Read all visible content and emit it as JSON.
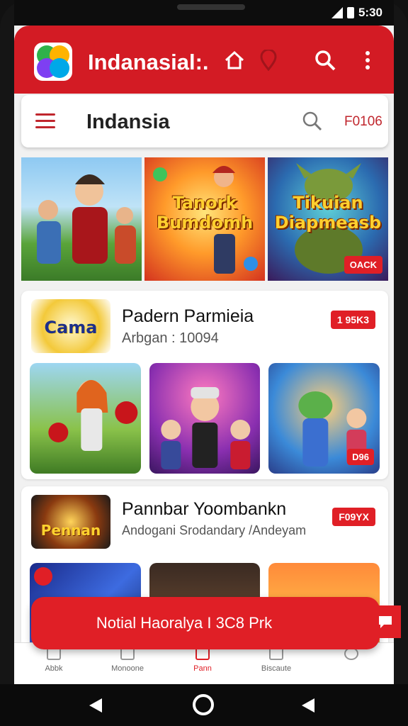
{
  "status": {
    "time": "5:30"
  },
  "app": {
    "title": "Indanasial:."
  },
  "subheader": {
    "title": "Indansia",
    "code": "F0106"
  },
  "banners": [
    {
      "title": "",
      "badge": ""
    },
    {
      "title": "Tanork Bumdomh",
      "badge": ""
    },
    {
      "title": "Tikuian Diapmeasb",
      "badge": "OACK"
    }
  ],
  "sections": [
    {
      "logo_text": "Cama",
      "title": "Padern Parmieia",
      "subtitle": "Arbgan : 10094",
      "badge": "1 95K3",
      "thumb_badges": [
        "",
        "",
        "D96"
      ]
    },
    {
      "logo_text": "Pennan",
      "title": "Pannbar Yoombankn",
      "subtitle": "Andogani Srodandary /Andeyam",
      "badge": "F09YX",
      "thumb_badges": [
        "",
        "",
        ""
      ]
    }
  ],
  "toast": {
    "text": "Notial Haoralya I 3C8 Prk"
  },
  "nav": {
    "items": [
      "Abbk",
      "Monoone",
      "Pann",
      "Biscaute",
      ""
    ]
  },
  "colors": {
    "brand_red": "#d31b24",
    "badge_red": "#e01f26"
  },
  "icons": [
    "home-icon",
    "pin-icon",
    "search-icon",
    "more-vert-icon",
    "menu-icon",
    "chat-icon"
  ]
}
